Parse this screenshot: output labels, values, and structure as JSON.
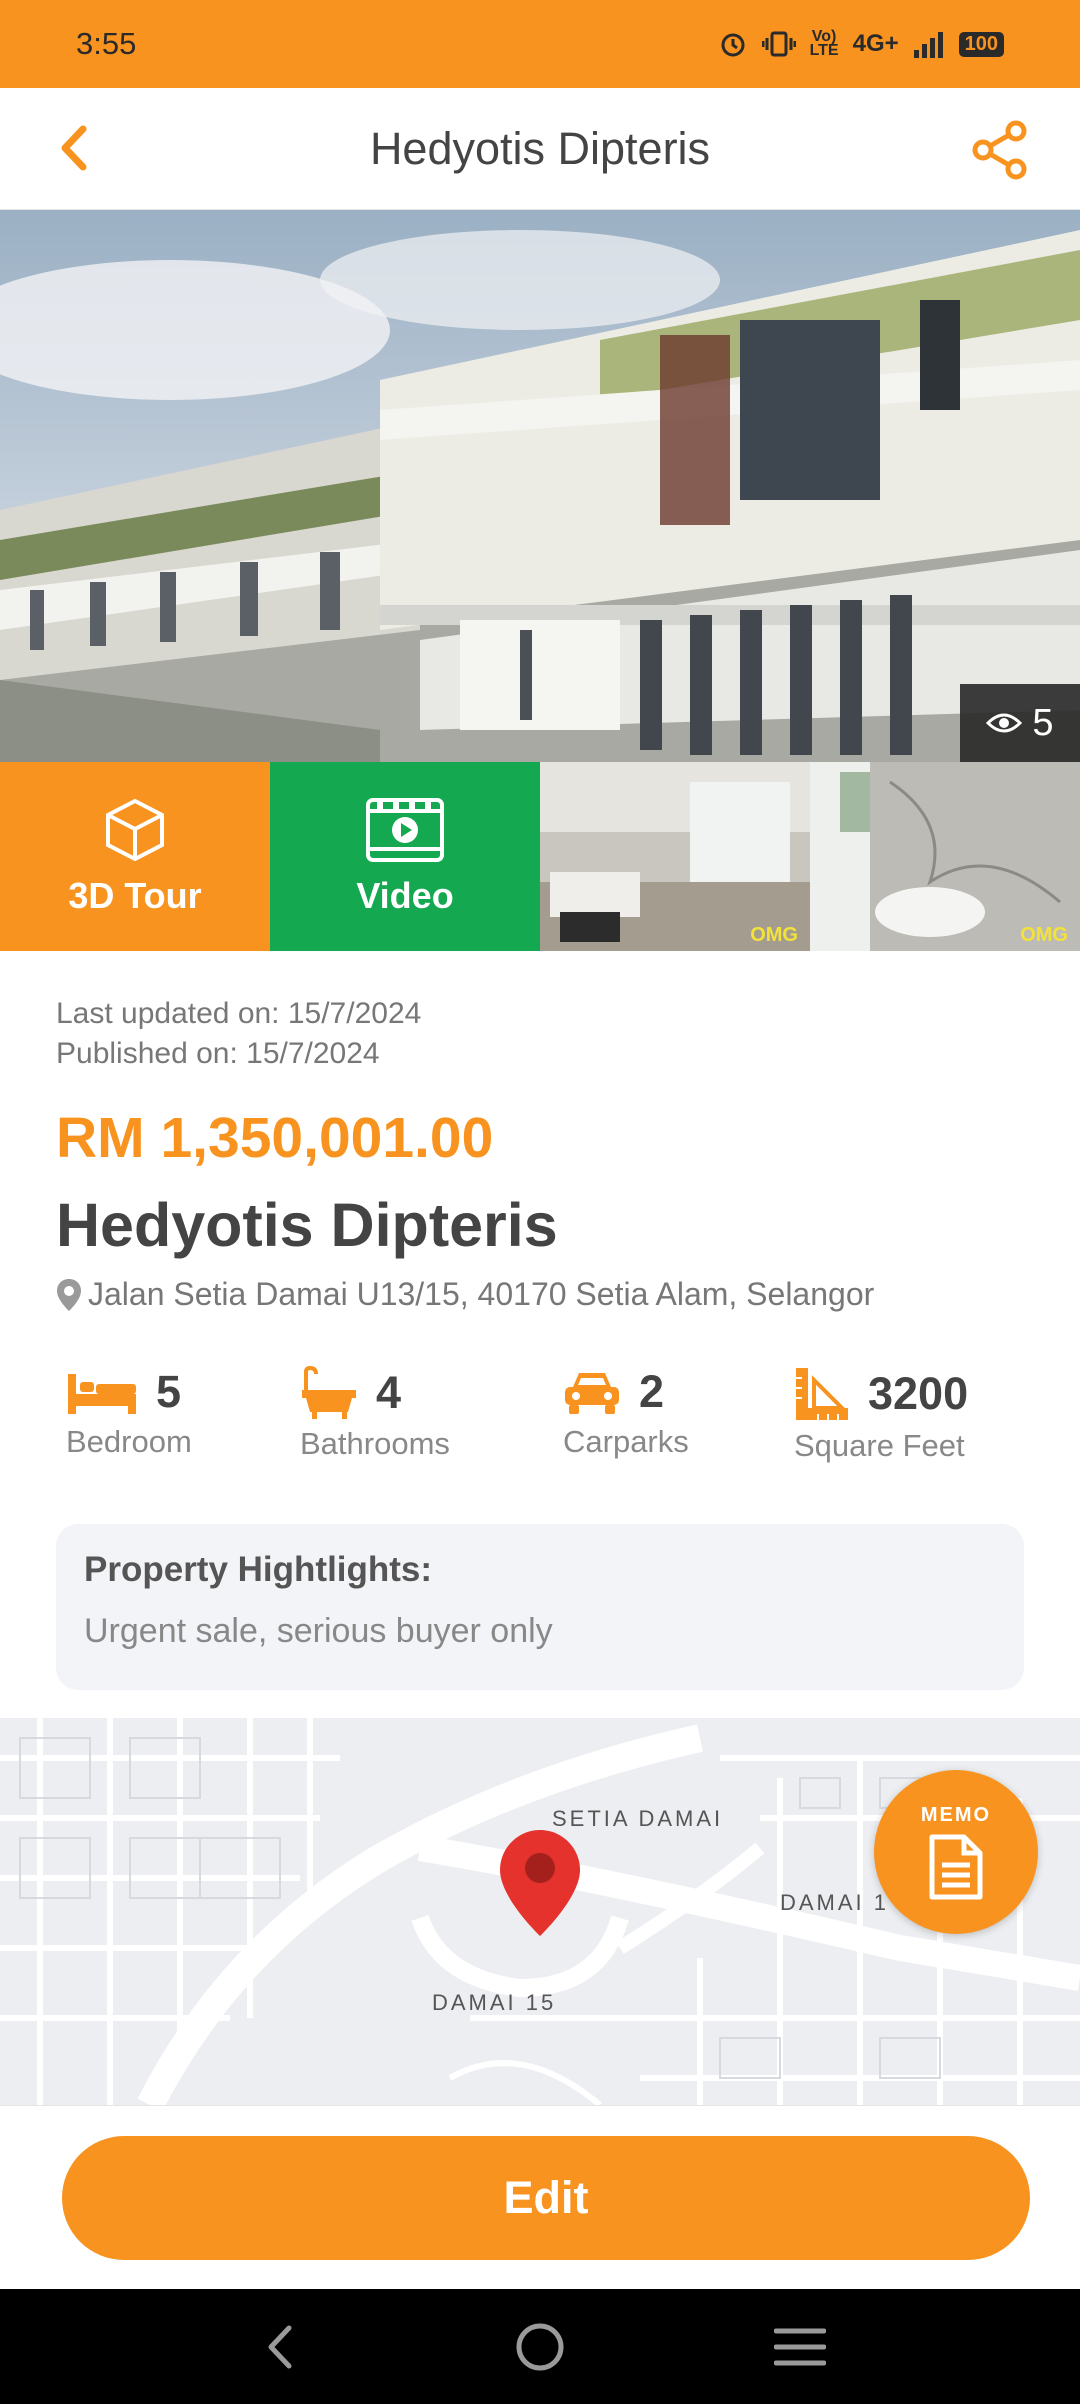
{
  "status_bar": {
    "time": "3:55",
    "network": "4G+",
    "battery": "100"
  },
  "app_bar": {
    "title": "Hedyotis Dipteris"
  },
  "hero": {
    "view_count": "5"
  },
  "media": {
    "tour_label": "3D Tour",
    "video_label": "Video",
    "thumb_logo": "OMG"
  },
  "details": {
    "last_updated": "Last updated on: 15/7/2024",
    "published": "Published on: 15/7/2024",
    "price": "RM 1,350,001.00",
    "name": "Hedyotis Dipteris",
    "address": "Jalan Setia Damai U13/15, 40170 Setia Alam, Selangor"
  },
  "features": [
    {
      "value": "5",
      "label": "Bedroom",
      "icon": "bed-icon"
    },
    {
      "value": "4",
      "label": "Bathrooms",
      "icon": "bathtub-icon"
    },
    {
      "value": "2",
      "label": "Carparks",
      "icon": "car-icon"
    },
    {
      "value": "3200",
      "label": "Square Feet",
      "icon": "ruler-icon"
    }
  ],
  "highlights": {
    "title": "Property Hightlights:",
    "text": "Urgent sale, serious buyer only"
  },
  "map": {
    "labels": [
      "SETIA DAMAI",
      "DAMAI 1",
      "DAMAI 15"
    ],
    "memo_label": "MEMO"
  },
  "actions": {
    "edit_label": "Edit"
  },
  "colors": {
    "accent": "#f7931e",
    "video": "#14a851"
  }
}
